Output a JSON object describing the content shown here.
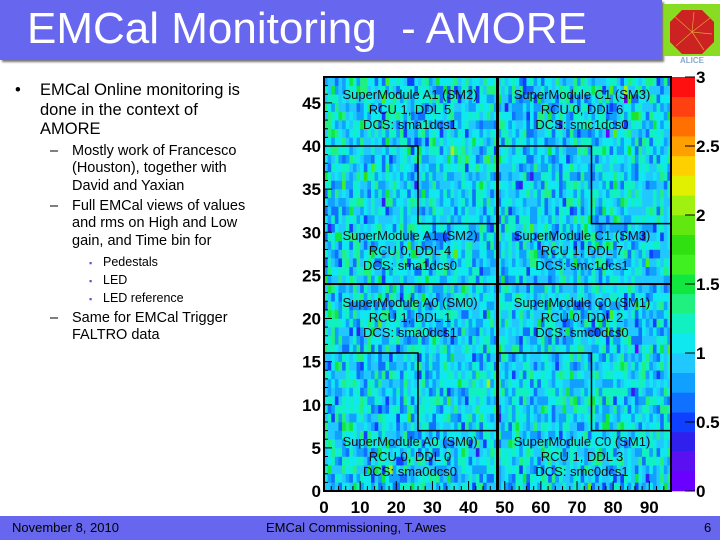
{
  "title": "EMCal Monitoring  - AMORE",
  "logo_text": "ALICE",
  "bullets": [
    {
      "level": 1,
      "marker": "•",
      "lines": [
        "EMCal Online monitoring is",
        "done in the context of",
        "AMORE"
      ]
    },
    {
      "level": 2,
      "marker": "–",
      "lines": [
        "Mostly work of Francesco",
        "(Houston), together with",
        "David and Yaxian"
      ]
    },
    {
      "level": 2,
      "marker": "–",
      "lines": [
        "Full EMCal views of values",
        "and rms on High and Low",
        "gain, and Time bin for"
      ]
    },
    {
      "level": 3,
      "marker": "▪",
      "lines": [
        "Pedestals"
      ]
    },
    {
      "level": 3,
      "marker": "▪",
      "lines": [
        "LED"
      ]
    },
    {
      "level": 3,
      "marker": "▪",
      "lines": [
        "LED reference"
      ]
    },
    {
      "level": 2,
      "marker": "–",
      "lines": [
        "Same for EMCal Trigger",
        "FALTRO data"
      ]
    }
  ],
  "footer": {
    "date": "November 8, 2010",
    "center": "EMCal Commissioning, T.Awes",
    "page": "6"
  },
  "colors": {
    "title_bar": "#6666ee",
    "footer_bar": "#6666ee",
    "title_text": "#ffffff"
  },
  "chart_data": {
    "type": "heatmap",
    "xlim": [
      0,
      96
    ],
    "ylim": [
      0,
      48
    ],
    "zlim": [
      0,
      3
    ],
    "x_ticks": [
      "0",
      "10",
      "20",
      "30",
      "40",
      "50",
      "60",
      "70",
      "80",
      "90"
    ],
    "y_ticks": [
      "0",
      "5",
      "10",
      "15",
      "20",
      "25",
      "30",
      "35",
      "40",
      "45"
    ],
    "z_ticks": [
      "0",
      "0.5",
      "1",
      "1.5",
      "2",
      "2.5",
      "3"
    ],
    "typical_value": 1,
    "regions": [
      {
        "lines": [
          "SuperModule A1 (SM2)",
          "RCU 1, DDL 5",
          "DCS: sma1dcs1"
        ]
      },
      {
        "lines": [
          "SuperModule C1 (SM3)",
          "RCU 0, DDL 6",
          "DCS: smc1dcs0"
        ]
      },
      {
        "lines": [
          "SuperModule A1 (SM2)",
          "RCU 0, DDL 4",
          "DCS: sma1dcs0"
        ]
      },
      {
        "lines": [
          "SuperModule C1 (SM3)",
          "RCU 1, DDL 7",
          "DCS: smc1dcs1"
        ]
      },
      {
        "lines": [
          "SuperModule A0 (SM0)",
          "RCU 1, DDL 1",
          "DCS: sma0dcs1"
        ]
      },
      {
        "lines": [
          "SuperModule C0 (SM1)",
          "RCU 0, DDL 2",
          "DCS: smc0dcs0"
        ]
      },
      {
        "lines": [
          "SuperModule A0 (SM0)",
          "RCU 0, DDL 0",
          "DCS: sma0dcs0"
        ]
      },
      {
        "lines": [
          "SuperModule C0 (SM1)",
          "RCU 1, DDL 3",
          "DCS: smc0dcs1"
        ]
      }
    ]
  }
}
